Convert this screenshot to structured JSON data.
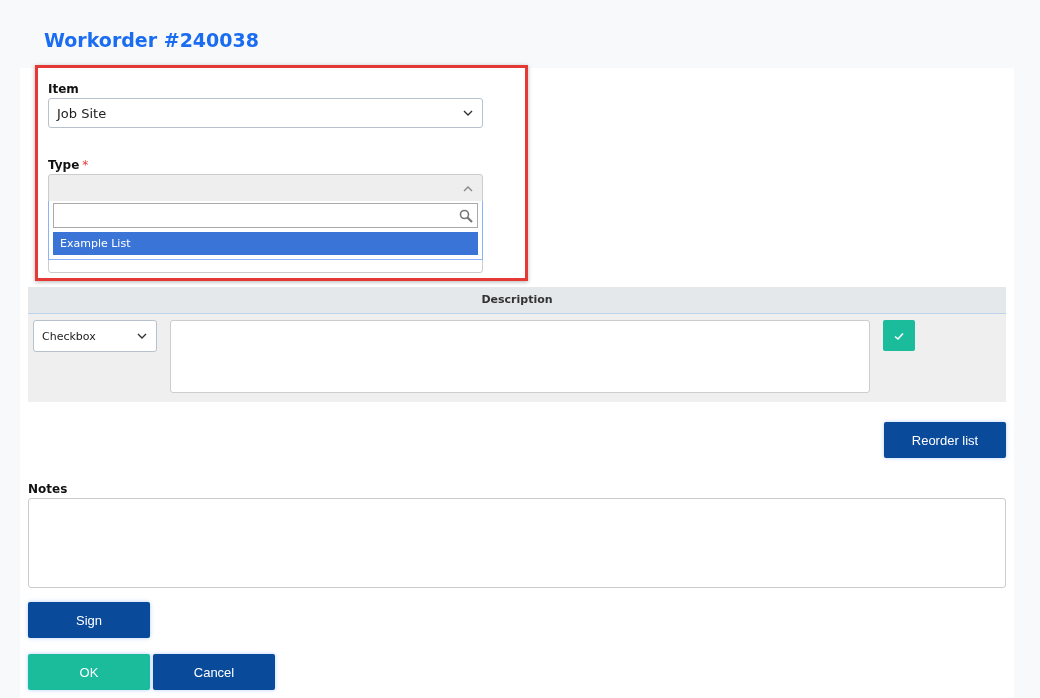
{
  "title": "Workorder #240038",
  "item_field": {
    "label": "Item",
    "value": "Job Site"
  },
  "type_field": {
    "label": "Type",
    "required": true,
    "required_mark": "*",
    "expanded": true,
    "options": [
      {
        "label": "Example List",
        "selected": true
      }
    ]
  },
  "description_table": {
    "header": "Description",
    "row": {
      "kind_value": "Checkbox"
    }
  },
  "reorder_button": "Reorder list",
  "notes": {
    "label": "Notes"
  },
  "sign_button": "Sign",
  "footer_buttons": [
    {
      "label": "OK",
      "kind": "primary"
    },
    {
      "label": "Cancel",
      "kind": "secondary"
    }
  ]
}
